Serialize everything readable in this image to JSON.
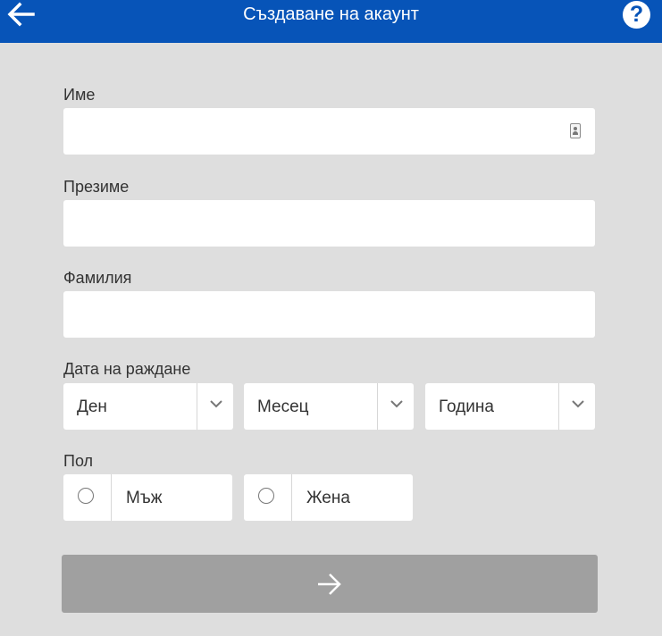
{
  "header": {
    "title": "Създаване на акаунт",
    "back_icon": "arrow-left-icon",
    "help_icon": "question-mark-icon",
    "help_glyph": "?",
    "background_color": "#0754b8"
  },
  "form": {
    "first_name": {
      "label": "Име",
      "value": "",
      "icon": "contact-card-icon"
    },
    "middle_name": {
      "label": "Презиме",
      "value": ""
    },
    "last_name": {
      "label": "Фамилия",
      "value": ""
    },
    "birth_date": {
      "label": "Дата на раждане",
      "day": {
        "selected": "Ден"
      },
      "month": {
        "selected": "Месец"
      },
      "year": {
        "selected": "Година"
      }
    },
    "gender": {
      "label": "Пол",
      "options": [
        {
          "label": "Мъж",
          "checked": false
        },
        {
          "label": "Жена",
          "checked": false
        }
      ]
    },
    "next_button": {
      "icon": "arrow-right-icon",
      "color": "#a0a0a0"
    }
  }
}
